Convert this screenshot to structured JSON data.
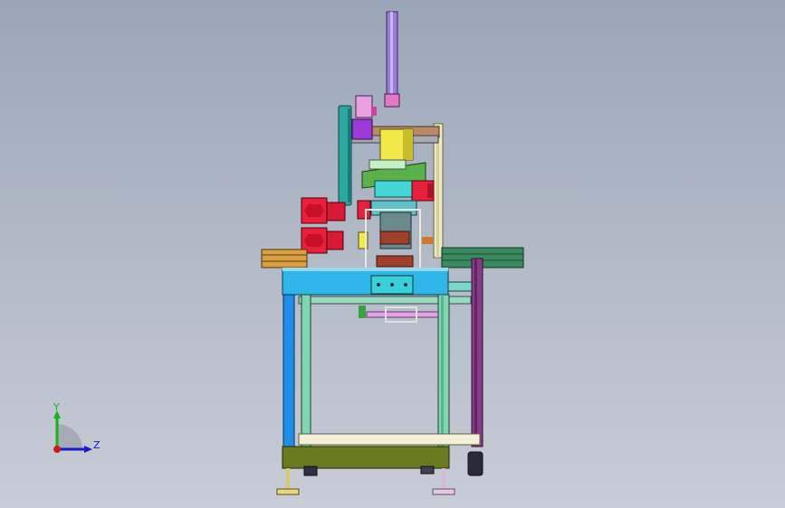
{
  "viewport": {
    "background_top": "#9aa6b8",
    "background_bottom": "#c8ccd6"
  },
  "triad": {
    "y_label": "Y",
    "z_label": "Z",
    "x_marker": "x-axis-dot",
    "colors": {
      "y": "#19b219",
      "z": "#1a1acc",
      "x": "#d01818",
      "arc": "#9aa0a8"
    }
  },
  "model": {
    "description_icon": "assembly-machine",
    "palette": {
      "frame_blue": "#1e8ee6",
      "frame_green": "#7fd6b0",
      "table_cyan": "#2fb6e8",
      "base_olive": "#6a7a1e",
      "purple_column": "#8a5ad8",
      "magenta": "#d01a7a",
      "red_motor": "#e8203c",
      "yellow": "#f2e84a",
      "teal": "#2aa8a0",
      "brown": "#a66a3a",
      "dark_purple": "#5a2a5a"
    }
  }
}
